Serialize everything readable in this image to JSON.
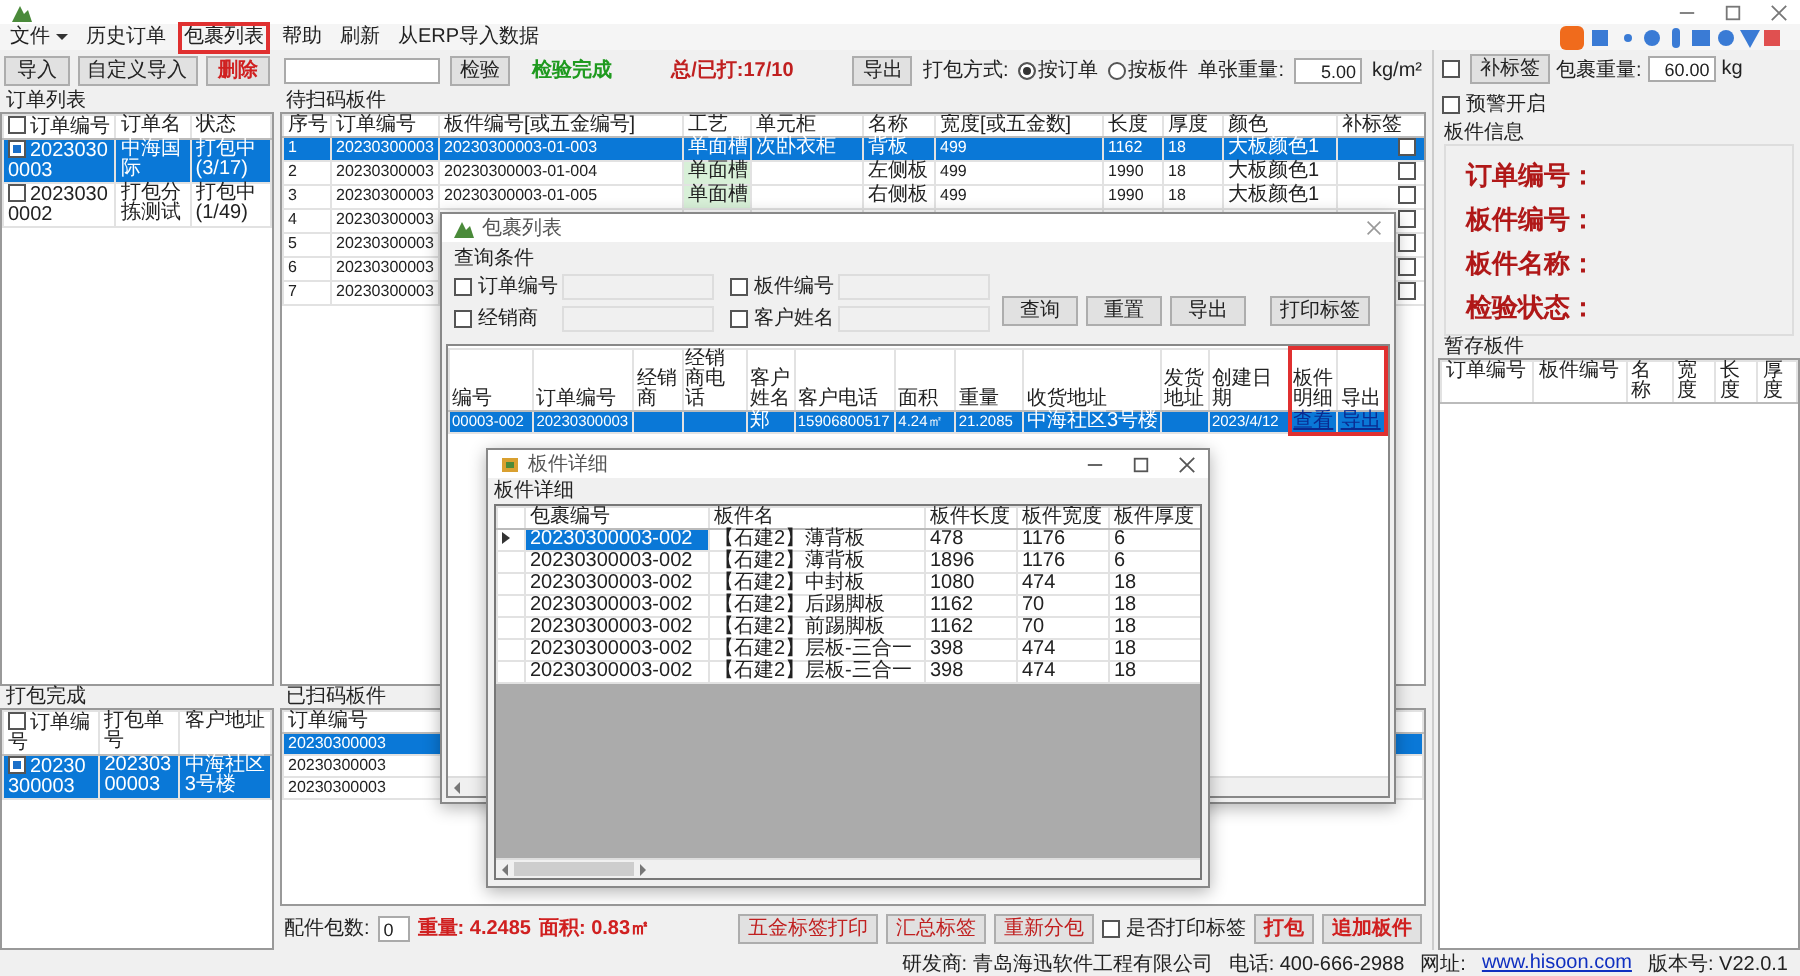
{
  "menu": [
    {
      "label": "文件",
      "dropdown": true,
      "annotated": false
    },
    {
      "label": "历史订单",
      "dropdown": false,
      "annotated": false
    },
    {
      "label": "包裹列表",
      "dropdown": false,
      "annotated": true
    },
    {
      "label": "帮助",
      "dropdown": false,
      "annotated": false
    },
    {
      "label": "刷新",
      "dropdown": false,
      "annotated": false
    },
    {
      "label": "从ERP导入数据",
      "dropdown": false,
      "annotated": false
    }
  ],
  "left": {
    "buttons": [
      {
        "label": "导入",
        "kind": "normal"
      },
      {
        "label": "自定义导入",
        "kind": "normal"
      },
      {
        "label": "删除",
        "kind": "danger"
      }
    ],
    "orders": {
      "title": "订单列表",
      "header_checked": false,
      "columns": [
        "订单编号",
        "订单名",
        "状态"
      ],
      "rows": [
        {
          "checked": true,
          "selected": true,
          "cells": [
            "20230300003",
            "中海国际",
            "打包中(3/17)"
          ]
        },
        {
          "checked": false,
          "selected": false,
          "cells": [
            "20230300002",
            "打包分拣测试",
            "打包中(1/49)"
          ]
        }
      ]
    },
    "packed": {
      "title": "打包完成",
      "header_checked": false,
      "columns": [
        "订单编号",
        "打包单号",
        "客户地址"
      ],
      "rows": [
        {
          "checked": true,
          "selected": true,
          "cells": [
            "20230300003",
            "20230300003",
            "中海社区3号楼"
          ]
        }
      ]
    }
  },
  "middle": {
    "toolbar": {
      "check_button": "检验",
      "status": "检验完成",
      "progress": "总/已打:17/10",
      "export_button": "导出",
      "pack_mode_label": "打包方式:",
      "pack_modes": [
        {
          "label": "按订单",
          "selected": true
        },
        {
          "label": "按板件",
          "selected": false
        }
      ],
      "weight_label": "单张重量:",
      "weight_value": "5.00",
      "weight_unit": "kg/m²"
    },
    "to_scan": {
      "title": "待扫码板件",
      "columns": [
        "序号",
        "订单编号",
        "板件编号[或五金编号]",
        "工艺",
        "单元柜",
        "名称",
        "宽度[或五金数]",
        "长度",
        "厚度",
        "颜色",
        "补标签"
      ],
      "rows": [
        {
          "selected": true,
          "label_checked": false,
          "cells": [
            "1",
            "20230300003",
            "20230300003-01-003",
            "单面槽",
            "次卧衣柜",
            "背板",
            "499",
            "1162",
            "18",
            "大板颜色1"
          ]
        },
        {
          "selected": false,
          "label_checked": false,
          "cells": [
            "2",
            "20230300003",
            "20230300003-01-004",
            "单面槽",
            "",
            "左侧板",
            "499",
            "1990",
            "18",
            "大板颜色1"
          ]
        },
        {
          "selected": false,
          "label_checked": false,
          "cells": [
            "3",
            "20230300003",
            "20230300003-01-005",
            "单面槽",
            "",
            "右侧板",
            "499",
            "1990",
            "18",
            "大板颜色1"
          ]
        },
        {
          "selected": false,
          "label_checked": false,
          "cells": [
            "4",
            "20230300003"
          ]
        },
        {
          "selected": false,
          "label_checked": false,
          "cells": [
            "5",
            "20230300003"
          ]
        },
        {
          "selected": false,
          "label_checked": false,
          "cells": [
            "6",
            "20230300003"
          ]
        },
        {
          "selected": false,
          "label_checked": false,
          "cells": [
            "7",
            "20230300003"
          ]
        }
      ]
    },
    "scanned": {
      "title": "已扫码板件",
      "columns": [
        "订单编号"
      ],
      "rows": [
        {
          "selected": true,
          "cells": [
            "20230300003"
          ]
        },
        {
          "selected": false,
          "cells": [
            "20230300003"
          ]
        },
        {
          "selected": false,
          "cells": [
            "20230300003"
          ]
        }
      ]
    },
    "footer": {
      "count_label": "配件包数:",
      "count_value": "0",
      "weight": "重量: 4.2485",
      "area": "面积: 0.83㎡",
      "buttons": [
        "五金标签打印",
        "汇总标签",
        "重新分包"
      ],
      "print_option": {
        "label": "是否打印标签",
        "checked": false
      },
      "action_buttons": [
        "打包",
        "追加板件"
      ]
    }
  },
  "right": {
    "supplement_checked": false,
    "supplement_button": "补标签",
    "package_weight_label": "包裹重量:",
    "package_weight_value": "60.00",
    "package_weight_unit": "kg",
    "alarm": {
      "label": "预警开启",
      "checked": false
    },
    "info": {
      "title": "板件信息",
      "fields": [
        "订单编号：",
        "板件编号：",
        "板件名称：",
        "检验状态："
      ]
    },
    "staging": {
      "title": "暂存板件",
      "columns": [
        "订单编号",
        "板件编号",
        "名称",
        "宽度",
        "长度",
        "厚度"
      ]
    }
  },
  "status_bar": [
    {
      "kind": "text",
      "text": "研发商: 青岛海迅软件工程有限公司"
    },
    {
      "kind": "text",
      "text": "电话: 400-666-2988"
    },
    {
      "kind": "text",
      "text": "网址:"
    },
    {
      "kind": "link",
      "text": "www.hisoon.com"
    },
    {
      "kind": "text",
      "text": "版本号: V22.0.1"
    }
  ],
  "package_dialog": {
    "title": "包裹列表",
    "query_title": "查询条件",
    "filters": [
      {
        "label": "订单编号",
        "checked": false
      },
      {
        "label": "板件编号",
        "checked": false
      },
      {
        "label": "经销商",
        "checked": false
      },
      {
        "label": "客户姓名",
        "checked": false
      }
    ],
    "buttons": [
      "查询",
      "重置",
      "导出"
    ],
    "print_button": "打印标签",
    "columns": [
      {
        "label": "编号",
        "annotated": false
      },
      {
        "label": "订单编号",
        "annotated": false
      },
      {
        "label": "经销商",
        "annotated": false
      },
      {
        "label": "经销商电话",
        "annotated": false
      },
      {
        "label": "客户姓名",
        "annotated": false
      },
      {
        "label": "客户电话",
        "annotated": false
      },
      {
        "label": "面积",
        "annotated": false
      },
      {
        "label": "重量",
        "annotated": false
      },
      {
        "label": "收货地址",
        "annotated": false
      },
      {
        "label": "发货地址",
        "annotated": false
      },
      {
        "label": "创建日期",
        "annotated": false
      },
      {
        "label": "板件明细",
        "annotated": true
      },
      {
        "label": "导出",
        "annotated": true
      }
    ],
    "rows": [
      {
        "selected": true,
        "cells": [
          {
            "kind": "text",
            "text": "00003-002"
          },
          {
            "kind": "text",
            "text": "20230300003"
          },
          {
            "kind": "text",
            "text": ""
          },
          {
            "kind": "text",
            "text": ""
          },
          {
            "kind": "text",
            "text": "郑"
          },
          {
            "kind": "text",
            "text": "15906800517"
          },
          {
            "kind": "text",
            "text": "4.24㎡"
          },
          {
            "kind": "text",
            "text": "21.2085"
          },
          {
            "kind": "text",
            "text": "中海社区3号楼"
          },
          {
            "kind": "text",
            "text": ""
          },
          {
            "kind": "text",
            "text": "2023/4/12"
          },
          {
            "kind": "link",
            "text": "查看"
          },
          {
            "kind": "link",
            "text": "导出"
          }
        ]
      }
    ]
  },
  "detail_dialog": {
    "title": "板件详细",
    "group_title": "板件详细",
    "columns": [
      "包裹编号",
      "板件名",
      "板件长度",
      "板件宽度",
      "板件厚度"
    ],
    "rows": [
      {
        "current": true,
        "cells": [
          "20230300003-002",
          "【石建2】薄背板",
          "478",
          "1176",
          "6"
        ]
      },
      {
        "current": false,
        "cells": [
          "20230300003-002",
          "【石建2】薄背板",
          "1896",
          "1176",
          "6"
        ]
      },
      {
        "current": false,
        "cells": [
          "20230300003-002",
          "【石建2】中封板",
          "1080",
          "474",
          "18"
        ]
      },
      {
        "current": false,
        "cells": [
          "20230300003-002",
          "【石建2】后踢脚板",
          "1162",
          "70",
          "18"
        ]
      },
      {
        "current": false,
        "cells": [
          "20230300003-002",
          "【石建2】前踢脚板",
          "1162",
          "70",
          "18"
        ]
      },
      {
        "current": false,
        "cells": [
          "20230300003-002",
          "【石建2】层板-三合一",
          "398",
          "474",
          "18"
        ]
      },
      {
        "current": false,
        "cells": [
          "20230300003-002",
          "【石建2】层板-三合一",
          "398",
          "474",
          "18"
        ]
      }
    ]
  }
}
